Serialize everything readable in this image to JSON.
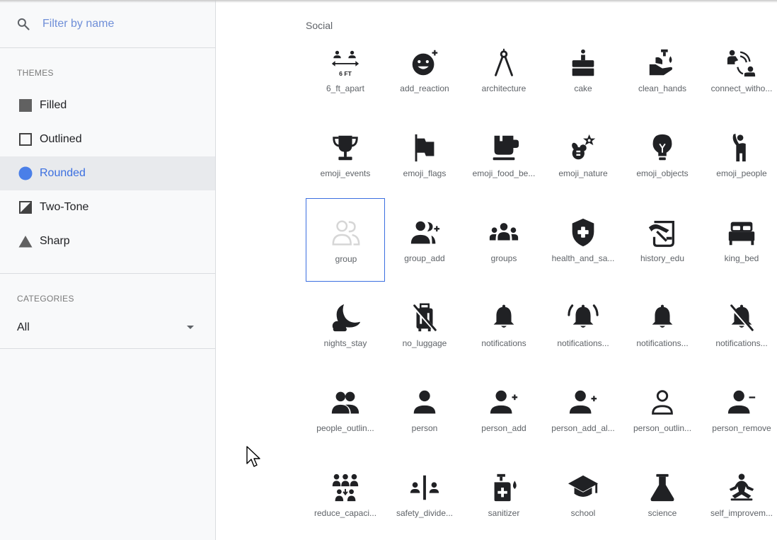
{
  "search": {
    "placeholder": "Filter by name",
    "value": ""
  },
  "themes": {
    "section_label": "THEMES",
    "items": [
      {
        "label": "Filled",
        "shape": "filled-square"
      },
      {
        "label": "Outlined",
        "shape": "outlined-square"
      },
      {
        "label": "Rounded",
        "shape": "circle",
        "selected": true
      },
      {
        "label": "Two-Tone",
        "shape": "two-tone-square"
      },
      {
        "label": "Sharp",
        "shape": "triangle"
      }
    ]
  },
  "categories": {
    "section_label": "CATEGORIES",
    "selected": "All"
  },
  "main": {
    "category_title": "Social",
    "icons": [
      {
        "label": "6_ft_apart",
        "icon": "six-ft-apart-icon"
      },
      {
        "label": "add_reaction",
        "icon": "add-reaction-icon"
      },
      {
        "label": "architecture",
        "icon": "architecture-icon"
      },
      {
        "label": "cake",
        "icon": "cake-icon"
      },
      {
        "label": "clean_hands",
        "icon": "clean-hands-icon"
      },
      {
        "label": "connect_witho...",
        "icon": "connect-without-contact-icon"
      },
      {
        "label": "emoji_events",
        "icon": "trophy-icon"
      },
      {
        "label": "emoji_flags",
        "icon": "flag-icon"
      },
      {
        "label": "emoji_food_be...",
        "icon": "food-beverage-icon"
      },
      {
        "label": "emoji_nature",
        "icon": "nature-icon"
      },
      {
        "label": "emoji_objects",
        "icon": "lightbulb-icon"
      },
      {
        "label": "emoji_people",
        "icon": "person-waving-icon"
      },
      {
        "label": "group",
        "icon": "group-icon",
        "selected": true
      },
      {
        "label": "group_add",
        "icon": "group-add-icon"
      },
      {
        "label": "groups",
        "icon": "groups-icon"
      },
      {
        "label": "health_and_sa...",
        "icon": "health-shield-icon"
      },
      {
        "label": "history_edu",
        "icon": "history-edu-icon"
      },
      {
        "label": "king_bed",
        "icon": "king-bed-icon"
      },
      {
        "label": "nights_stay",
        "icon": "moon-cloud-icon"
      },
      {
        "label": "no_luggage",
        "icon": "no-luggage-icon"
      },
      {
        "label": "notifications",
        "icon": "bell-icon"
      },
      {
        "label": "notifications...",
        "icon": "bell-active-icon"
      },
      {
        "label": "notifications...",
        "icon": "bell-none-icon"
      },
      {
        "label": "notifications...",
        "icon": "bell-off-icon"
      },
      {
        "label": "people_outlin...",
        "icon": "people-outline-icon"
      },
      {
        "label": "person",
        "icon": "person-icon"
      },
      {
        "label": "person_add",
        "icon": "person-add-icon"
      },
      {
        "label": "person_add_al...",
        "icon": "person-add-alt-icon"
      },
      {
        "label": "person_outlin...",
        "icon": "person-outline-icon"
      },
      {
        "label": "person_remove",
        "icon": "person-remove-icon"
      },
      {
        "label": "reduce_capaci...",
        "icon": "reduce-capacity-icon"
      },
      {
        "label": "safety_divide...",
        "icon": "safety-divider-icon"
      },
      {
        "label": "sanitizer",
        "icon": "sanitizer-icon"
      },
      {
        "label": "school",
        "icon": "school-icon"
      },
      {
        "label": "science",
        "icon": "flask-icon"
      },
      {
        "label": "self_improvem...",
        "icon": "meditation-icon"
      }
    ]
  },
  "colors": {
    "accent": "#3b6fe0",
    "icon": "#202124",
    "selected_bg": "#e8eaed"
  }
}
